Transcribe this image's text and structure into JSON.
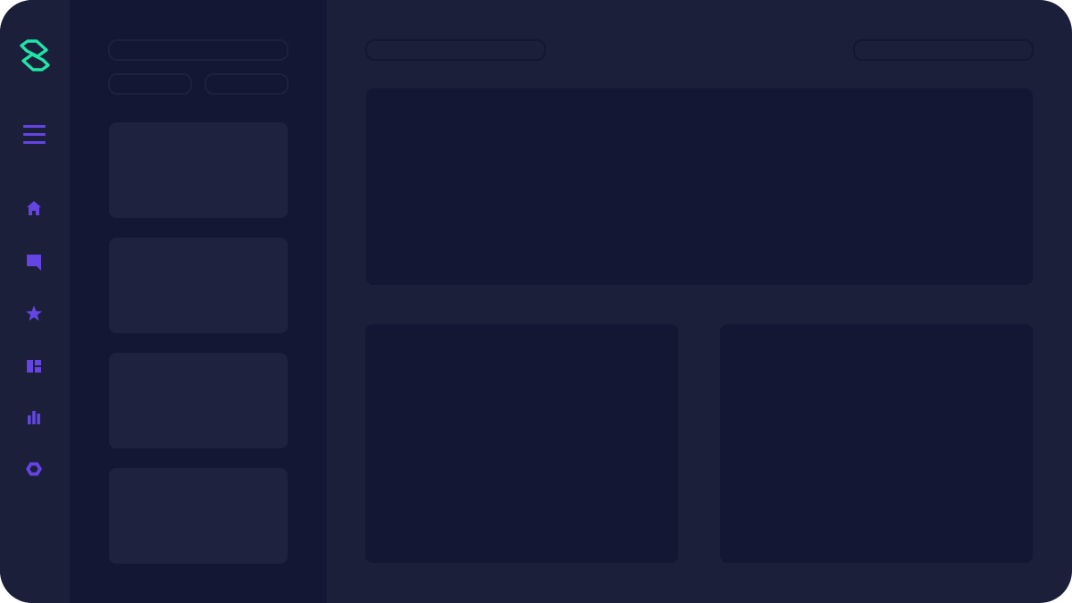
{
  "theme": {
    "rail_bg": "#1c1f3a",
    "panel_bg": "#131733",
    "main_bg": "#1c1f3a",
    "card_bg": "#1e223f",
    "block_bg": "#131733",
    "accent": "#6445e3",
    "brand": "#1ee5a8"
  },
  "rail": {
    "logo_icon": "s-logo-icon",
    "menu_icon": "hamburger-menu-icon",
    "items": [
      {
        "icon": "home-icon"
      },
      {
        "icon": "chat-icon"
      },
      {
        "icon": "star-icon"
      },
      {
        "icon": "dashboard-icon"
      },
      {
        "icon": "bar-chart-icon"
      },
      {
        "icon": "hexagon-settings-icon"
      }
    ]
  },
  "panel": {
    "search_placeholder": "",
    "filters": [
      "",
      ""
    ],
    "cards": [
      "",
      "",
      "",
      ""
    ]
  },
  "main": {
    "header_left_placeholder": "",
    "header_right_placeholder": "",
    "blocks": [
      "",
      "",
      ""
    ]
  }
}
